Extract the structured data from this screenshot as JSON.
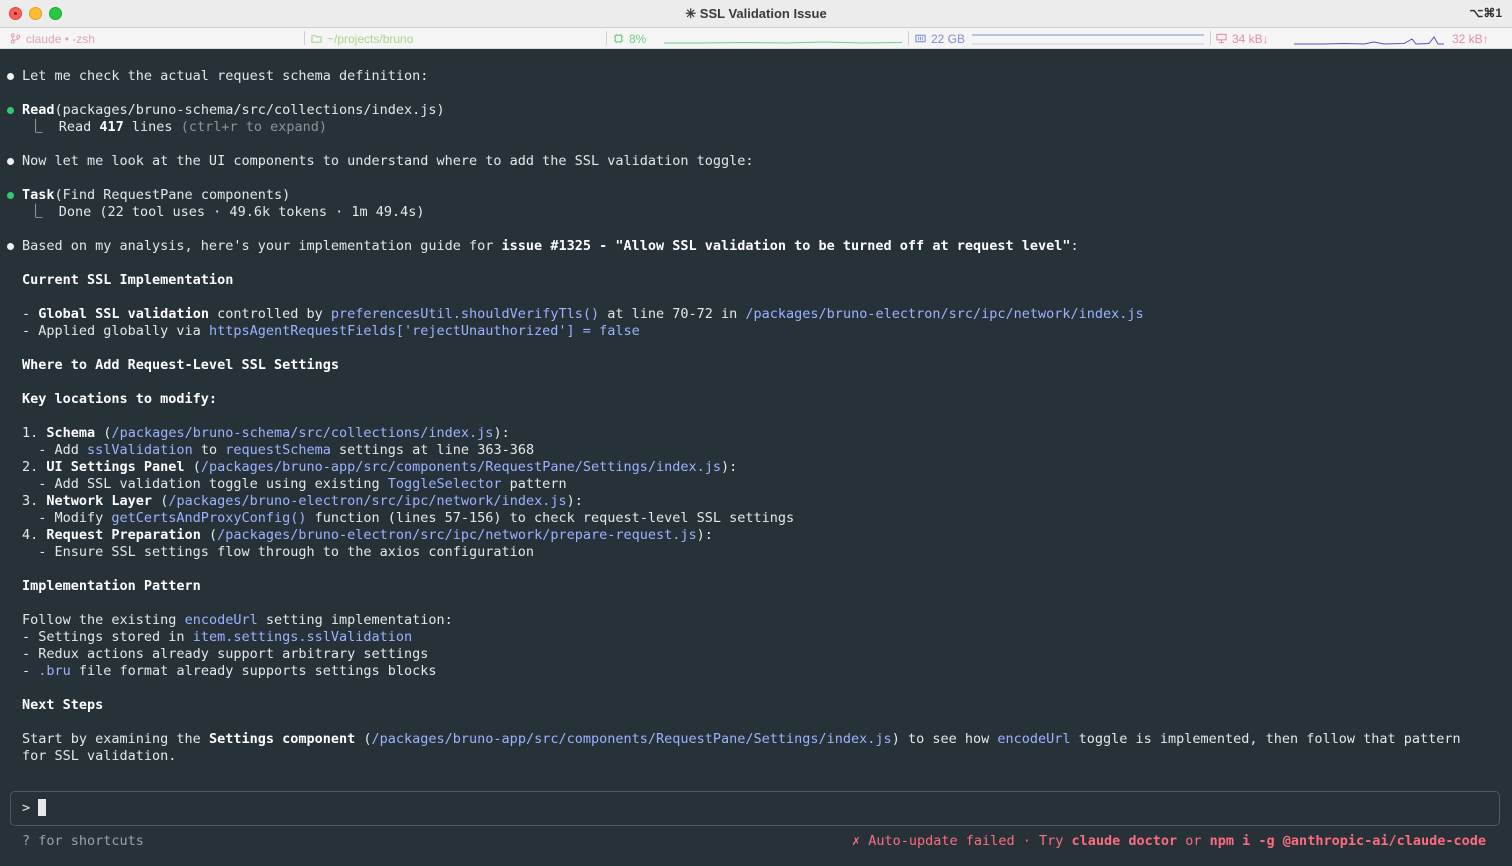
{
  "window": {
    "title": "✳ SSL Validation Issue",
    "shortcut": "⌥⌘1"
  },
  "statusbar": {
    "shell": "claude • -zsh",
    "cwd": "~/projects/bruno",
    "cpu": "8%",
    "mem": "22 GB",
    "net_down": "34 kB↓",
    "net_up": "32 kB↑",
    "colors": {
      "shell": "#e0a5b5",
      "cwd": "#a8d68a",
      "cpu": "#6fd08c",
      "mem": "#7f8fd6",
      "net": "#e88ab0"
    }
  },
  "transcript": [
    {
      "bullet": "white",
      "parts": [
        {
          "t": "Let me check the actual request schema definition:"
        }
      ]
    },
    {
      "bullet": "green",
      "parts": [
        {
          "t": "Read",
          "s": "b"
        },
        {
          "t": "(packages/bruno-schema/src/collections/index.js)"
        }
      ]
    },
    {
      "indent": true,
      "parts": [
        {
          "t": "⎿  Read "
        },
        {
          "t": "417",
          "s": "b"
        },
        {
          "t": " lines "
        },
        {
          "t": "(ctrl+r to expand)",
          "s": "dim"
        }
      ]
    },
    {
      "bullet": "white",
      "parts": [
        {
          "t": "Now let me look at the UI components to understand where to add the SSL validation toggle:"
        }
      ]
    },
    {
      "bullet": "green",
      "parts": [
        {
          "t": "Task",
          "s": "b"
        },
        {
          "t": "(Find RequestPane components)"
        }
      ]
    },
    {
      "indent": true,
      "parts": [
        {
          "t": "⎿  Done (22 tool uses · 49.6k tokens · 1m 49.4s)"
        }
      ]
    },
    {
      "bullet": "white",
      "parts": [
        {
          "t": "Based on my analysis, here's your implementation guide for "
        },
        {
          "t": "issue #1325 - \"Allow SSL validation to be turned off at request level\"",
          "s": "b"
        },
        {
          "t": ":"
        }
      ]
    },
    {
      "parts": [
        {
          "t": "Current SSL Implementation",
          "s": "b"
        }
      ]
    },
    {
      "parts": [
        {
          "t": "- "
        },
        {
          "t": "Global SSL validation",
          "s": "b"
        },
        {
          "t": " controlled by "
        },
        {
          "t": "preferencesUtil.shouldVerifyTls()",
          "s": "path"
        },
        {
          "t": " at line 70-72 in "
        },
        {
          "t": "/packages/bruno-electron/src/ipc/network/index.js",
          "s": "path"
        }
      ]
    },
    {
      "parts": [
        {
          "t": "- Applied globally via "
        },
        {
          "t": "httpsAgentRequestFields['rejectUnauthorized'] = false",
          "s": "path"
        }
      ]
    },
    {
      "parts": [
        {
          "t": "Where to Add Request-Level SSL Settings",
          "s": "b"
        }
      ]
    },
    {
      "parts": [
        {
          "t": "Key locations to modify:",
          "s": "b"
        }
      ]
    },
    {
      "parts": [
        {
          "t": "1. "
        },
        {
          "t": "Schema",
          "s": "b"
        },
        {
          "t": " ("
        },
        {
          "t": "/packages/bruno-schema/src/collections/index.js",
          "s": "path"
        },
        {
          "t": "):"
        }
      ]
    },
    {
      "parts": [
        {
          "t": "  - Add "
        },
        {
          "t": "sslValidation",
          "s": "path"
        },
        {
          "t": " to "
        },
        {
          "t": "requestSchema",
          "s": "path"
        },
        {
          "t": " settings at line 363-368"
        }
      ]
    },
    {
      "parts": [
        {
          "t": "2. "
        },
        {
          "t": "UI Settings Panel",
          "s": "b"
        },
        {
          "t": " ("
        },
        {
          "t": "/packages/bruno-app/src/components/RequestPane/Settings/index.js",
          "s": "path"
        },
        {
          "t": "):"
        }
      ]
    },
    {
      "parts": [
        {
          "t": "  - Add SSL validation toggle using existing "
        },
        {
          "t": "ToggleSelector",
          "s": "path"
        },
        {
          "t": " pattern"
        }
      ]
    },
    {
      "parts": [
        {
          "t": "3. "
        },
        {
          "t": "Network Layer",
          "s": "b"
        },
        {
          "t": " ("
        },
        {
          "t": "/packages/bruno-electron/src/ipc/network/index.js",
          "s": "path"
        },
        {
          "t": "):"
        }
      ]
    },
    {
      "parts": [
        {
          "t": "  - Modify "
        },
        {
          "t": "getCertsAndProxyConfig()",
          "s": "path"
        },
        {
          "t": " function (lines 57-156) to check request-level SSL settings"
        }
      ]
    },
    {
      "parts": [
        {
          "t": "4. "
        },
        {
          "t": "Request Preparation",
          "s": "b"
        },
        {
          "t": " ("
        },
        {
          "t": "/packages/bruno-electron/src/ipc/network/prepare-request.js",
          "s": "path"
        },
        {
          "t": "):"
        }
      ]
    },
    {
      "parts": [
        {
          "t": "  - Ensure SSL settings flow through to the axios configuration"
        }
      ]
    },
    {
      "parts": [
        {
          "t": "Implementation Pattern",
          "s": "b"
        }
      ]
    },
    {
      "parts": [
        {
          "t": "Follow the existing "
        },
        {
          "t": "encodeUrl",
          "s": "path"
        },
        {
          "t": " setting implementation:"
        }
      ]
    },
    {
      "parts": [
        {
          "t": "- Settings stored in "
        },
        {
          "t": "item.settings.sslValidation",
          "s": "path"
        }
      ]
    },
    {
      "parts": [
        {
          "t": "- Redux actions already support arbitrary settings"
        }
      ]
    },
    {
      "parts": [
        {
          "t": "- "
        },
        {
          "t": ".bru",
          "s": "path"
        },
        {
          "t": " file format already supports settings blocks"
        }
      ]
    },
    {
      "parts": [
        {
          "t": "Next Steps",
          "s": "b"
        }
      ]
    },
    {
      "parts": [
        {
          "t": "Start by examining the "
        },
        {
          "t": "Settings component",
          "s": "b"
        },
        {
          "t": " ("
        },
        {
          "t": "/packages/bruno-app/src/components/RequestPane/Settings/index.js",
          "s": "path"
        },
        {
          "t": ") to see how "
        },
        {
          "t": "encodeUrl",
          "s": "path"
        },
        {
          "t": " toggle is implemented, then follow that pattern"
        }
      ]
    },
    {
      "parts": [
        {
          "t": "for SSL validation."
        }
      ]
    }
  ],
  "input": {
    "prompt": ">"
  },
  "footer": {
    "hint": "? for shortcuts",
    "update_prefix": "✗ Auto-update failed · Try ",
    "cmd1": "claude doctor",
    "or": " or ",
    "cmd2": "npm i -g @anthropic-ai/claude-code"
  }
}
